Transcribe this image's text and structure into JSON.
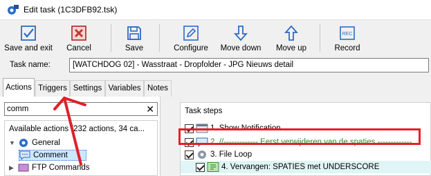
{
  "window": {
    "title": "Edit task (1C3DFB92.tsk)"
  },
  "toolbar": {
    "save_exit": "Save and exit",
    "cancel": "Cancel",
    "save": "Save",
    "configure": "Configure",
    "move_down": "Move down",
    "move_up": "Move up",
    "record": "Record",
    "record_badge": "REC"
  },
  "task_name": {
    "label": "Task name:",
    "value": "[WATCHDOG 02] - Wasstraat - Dropfolder - JPG Nieuws detail"
  },
  "tabs": [
    {
      "label": "Actions",
      "active": true
    },
    {
      "label": "Triggers",
      "active": false
    },
    {
      "label": "Settings",
      "active": false
    },
    {
      "label": "Variables",
      "active": false
    },
    {
      "label": "Notes",
      "active": false
    }
  ],
  "left": {
    "search_value": "comm",
    "clear_glyph": "✕",
    "available_header": "Available actions (232 actions, 34 ca...",
    "tree": [
      {
        "label": "General",
        "expanded": true
      },
      {
        "label": "Comment",
        "selected": true
      },
      {
        "label": "FTP Commands",
        "expanded": false
      }
    ]
  },
  "right": {
    "header": "Task steps",
    "steps": [
      {
        "label": "1. Show Notification",
        "type": "notification"
      },
      {
        "label": "2. //------------- Eerst verwijderen van de spaties -------------",
        "type": "comment"
      },
      {
        "label": "3. File Loop",
        "type": "loop"
      },
      {
        "label": "4. Vervangen: SPATIES met UNDERSCORE",
        "type": "replace"
      }
    ]
  },
  "colors": {
    "annotation": "#e0202a",
    "comment_text": "#2e8b2e",
    "accent": "#2b6cc4"
  }
}
